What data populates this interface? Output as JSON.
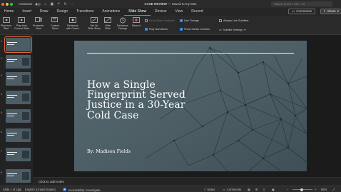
{
  "titlebar": {
    "autosave_label": "AutoSave",
    "doc_name": "CASE REVIEW",
    "doc_status": " — Saved to my Mac",
    "search_placeholder": "Search (Cmd + Ctrl + U)"
  },
  "tabs": [
    {
      "label": "Home",
      "active": false
    },
    {
      "label": "Insert",
      "active": false
    },
    {
      "label": "Draw",
      "active": false
    },
    {
      "label": "Design",
      "active": false
    },
    {
      "label": "Transitions",
      "active": false
    },
    {
      "label": "Animations",
      "active": false
    },
    {
      "label": "Slide Show",
      "active": true
    },
    {
      "label": "Review",
      "active": false
    },
    {
      "label": "View",
      "active": false
    },
    {
      "label": "Record",
      "active": false
    }
  ],
  "actions": {
    "comments": "Comments",
    "share": "Share"
  },
  "toolbar": {
    "play_start_1": "Play from",
    "play_start_2": "Start",
    "play_current_1": "Play from",
    "play_current_2": "Current Slide",
    "presenter_1": "Presenter",
    "presenter_2": "View",
    "custom_1": "Custom",
    "custom_2": "Show",
    "rehearse_coach_1": "Rehearse",
    "rehearse_coach_2": "with Coach",
    "setup_1": "Set Up",
    "setup_2": "Slide Show",
    "hide_1": "Hide",
    "hide_2": "Slide",
    "rehearse_timings_1": "Rehearse",
    "rehearse_timings_2": "Timings",
    "record": "Record",
    "keep_slides_updated": "Keep Slides Updated",
    "play_narrations": "Play Narrations",
    "use_timings": "Use Timings",
    "show_media_controls": "Show Media Controls",
    "always_use_subtitles": "Always Use Subtitles",
    "subtitle_settings": "Subtitle Settings"
  },
  "thumbnails": [
    {
      "num": "1",
      "selected": true
    },
    {
      "num": "2",
      "selected": false
    },
    {
      "num": "3",
      "selected": false
    },
    {
      "num": "4",
      "selected": false
    },
    {
      "num": "5",
      "selected": false
    },
    {
      "num": "6",
      "selected": false
    },
    {
      "num": "7",
      "selected": false
    },
    {
      "num": "8",
      "selected": false
    }
  ],
  "slide": {
    "title": "How a Single Fingerprint Served Justice in a 30-Year Cold Case",
    "author": "By: Madison Fields",
    "background_color": "#4f6168"
  },
  "notes": {
    "placeholder": "Click to add notes"
  },
  "status": {
    "slide_of": "Slide 1 of 11",
    "language": "English (United States)",
    "accessibility": "Accessibility: Investigate",
    "notes": "Notes",
    "comments": "Comments",
    "zoom": "86%",
    "zoom_fraction": 0.45
  },
  "colors": {
    "accent": "#e0683a",
    "checkbox": "#2d7bd4"
  }
}
